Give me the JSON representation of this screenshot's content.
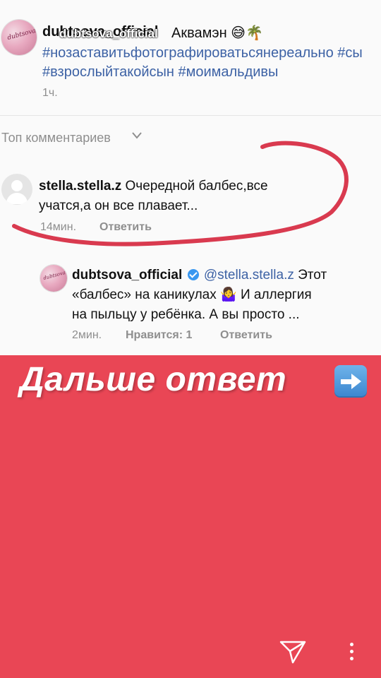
{
  "post": {
    "username": "dubtsova_official",
    "overlay_username": "dubtsova_official",
    "caption_text": "Аквамэн 😅🌴",
    "hashtags_line1": "#нозаставитьфотографироватьсянереально #сы",
    "hashtags_line2": "#взрослыйтакойсын #моимальдивы",
    "time": "1ч."
  },
  "top_comments": {
    "label": "Топ комментариев"
  },
  "comment": {
    "username": "stella.stella.z",
    "text_line1": " Очередной балбес,все",
    "text_line2": "учатся,а он все плавает...",
    "time": "14мин.",
    "reply_label": "Ответить"
  },
  "reply": {
    "username": "dubtsova_official",
    "mention": "@stella.stella.z",
    "text_after_mention": " Этот",
    "text_line2": "«балбес» на каникулах 🤷‍♀️ И аллергия",
    "text_line3": "на пыльцу у  ребёнка. А вы просто ...",
    "time": "2мин.",
    "likes": "Нравится: 1",
    "reply_label": "Ответить"
  },
  "banner": {
    "text": "Дальше ответ"
  },
  "icons": {
    "send": "send-icon",
    "more": "more-vertical-icon",
    "verified": "verified-badge-icon",
    "arrow": "right-arrow-emoji-icon",
    "chevron": "chevron-down-icon"
  },
  "colors": {
    "banner_background": "#e94655",
    "link": "#3d62a5",
    "scribble": "#d93a4f",
    "verified": "#3897f0"
  }
}
